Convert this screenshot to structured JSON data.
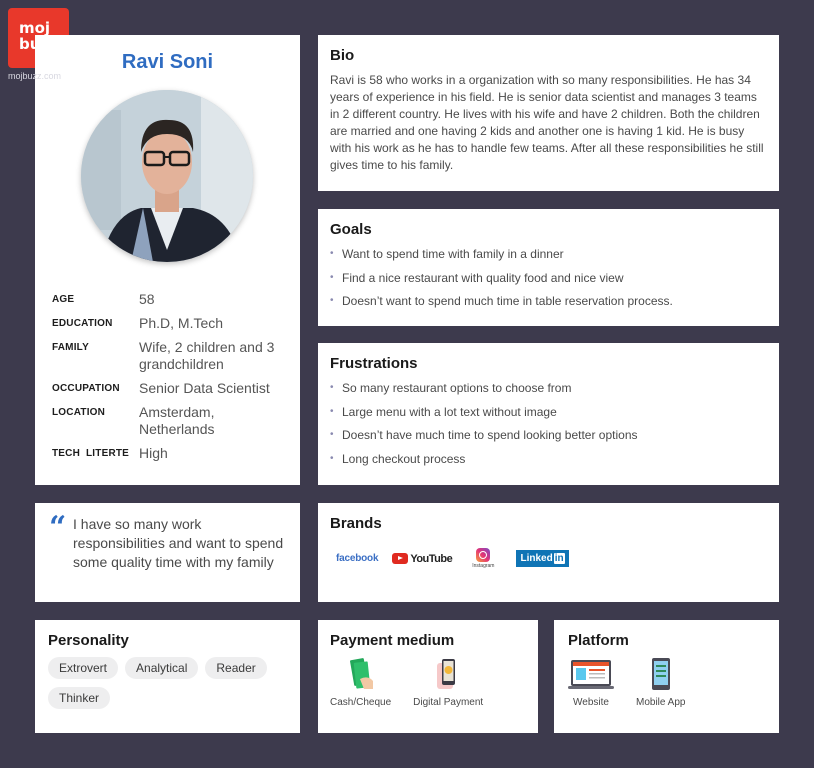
{
  "logo": {
    "text_line1": "moj",
    "text_line2": "buzz",
    "url": "mojbuzz.com"
  },
  "profile": {
    "name": "Ravi Soni",
    "facts": [
      {
        "label": "AGE",
        "value": "58"
      },
      {
        "label": "EDUCATION",
        "value": "Ph.D, M.Tech"
      },
      {
        "label": "FAMILY",
        "value": "Wife, 2 children and 3 grandchildren"
      },
      {
        "label": "OCCUPATION",
        "value": "Senior Data Scientist"
      },
      {
        "label": "LOCATION",
        "value": "Amsterdam, Netherlands"
      },
      {
        "label": "TECH  LITERTE",
        "value": "High"
      }
    ]
  },
  "bio": {
    "title": "Bio",
    "text": "Ravi is 58 who works in a organization with so many responsibilities. He has 34 years of experience in his field. He is senior data scientist and manages 3 teams in 2 different country. He lives with his wife and have 2 children. Both the children are married and one having 2 kids and another one is having 1 kid. He is busy with his work as he has to handle few teams. After all these responsibilities he still gives time to his family."
  },
  "goals": {
    "title": "Goals",
    "items": [
      "Want to spend time with family in a dinner",
      "Find a nice restaurant with quality food and nice view",
      "Doesn’t want to spend much time in table reservation process."
    ]
  },
  "frustrations": {
    "title": "Frustrations",
    "items": [
      "So many restaurant options to choose from",
      "Large menu with a lot text without image",
      "Doesn’t have much time to spend looking better options",
      "Long checkout process"
    ]
  },
  "quote": {
    "mark": "“",
    "text": "I have so many work responsibilities and want to spend some quality time with my family"
  },
  "brands": {
    "title": "Brands",
    "items": [
      {
        "name": "facebook",
        "icon": "facebook-logo"
      },
      {
        "name": "YouTube",
        "icon": "youtube-logo"
      },
      {
        "name": "Instagram",
        "icon": "instagram-logo"
      },
      {
        "name": "Linked",
        "suffix": "in",
        "icon": "linkedin-logo"
      }
    ]
  },
  "personality": {
    "title": "Personality",
    "traits": [
      "Extrovert",
      "Analytical",
      "Reader",
      "Thinker"
    ]
  },
  "payment": {
    "title": "Payment medium",
    "options": [
      {
        "label": "Cash/Cheque",
        "icon": "cash-icon"
      },
      {
        "label": "Digital Payment",
        "icon": "digital-payment-icon"
      }
    ]
  },
  "platform": {
    "title": "Platform",
    "options": [
      {
        "label": "Website",
        "icon": "laptop-icon"
      },
      {
        "label": "Mobile App",
        "icon": "mobile-icon"
      }
    ]
  },
  "colors": {
    "background": "#3d3a4d",
    "accent": "#2f6cc1",
    "logo": "#e8382b"
  }
}
